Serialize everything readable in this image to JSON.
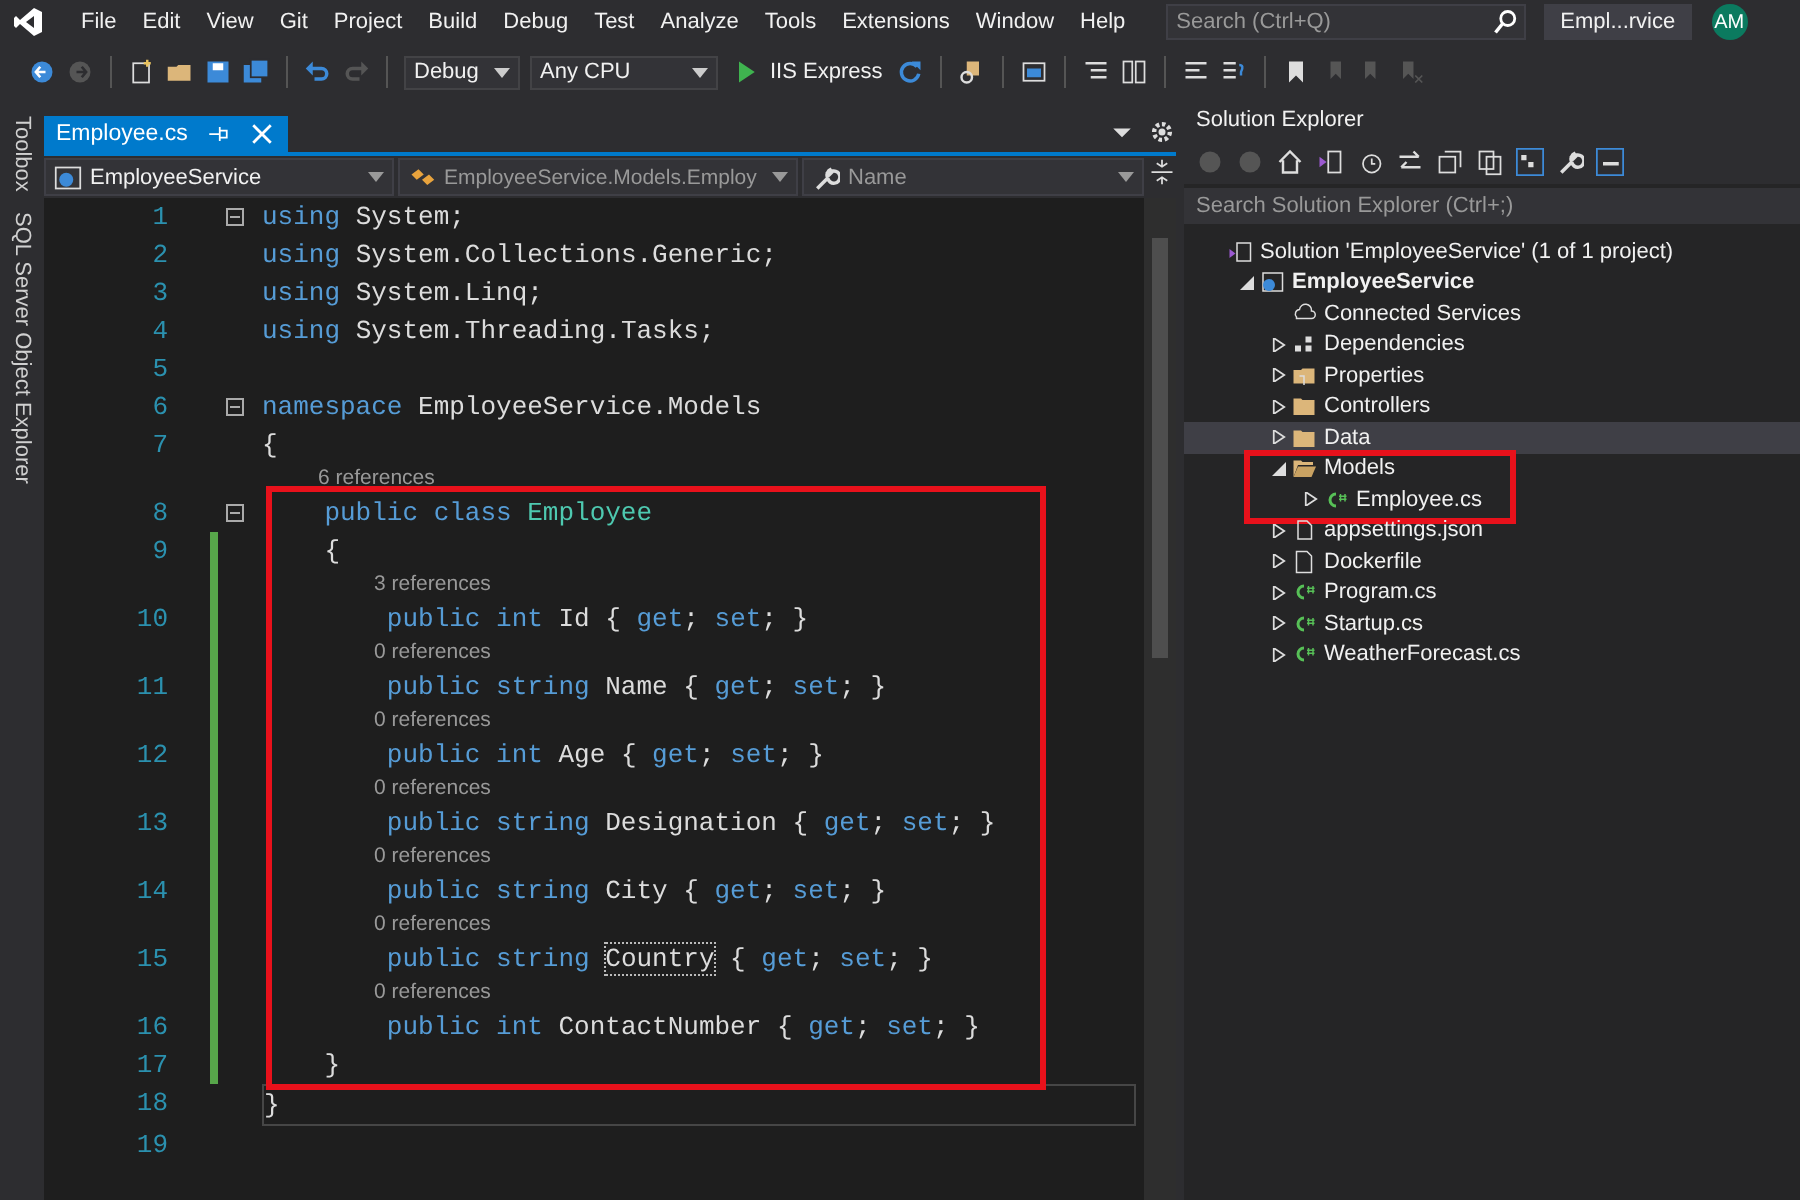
{
  "menu": {
    "items": [
      "File",
      "Edit",
      "View",
      "Git",
      "Project",
      "Build",
      "Debug",
      "Test",
      "Analyze",
      "Tools",
      "Extensions",
      "Window",
      "Help"
    ],
    "search": {
      "placeholder": "Search (Ctrl+Q)"
    },
    "solution_title": "Empl...rvice",
    "avatar": "AM"
  },
  "toolbar": {
    "configuration": "Debug",
    "platform": "Any CPU",
    "run_target": "IIS Express"
  },
  "side_tabs": [
    "Toolbox",
    "SQL Server Object Explorer"
  ],
  "editor": {
    "tab": {
      "label": "Employee.cs",
      "selected": true
    },
    "nav": [
      "EmployeeService",
      "EmployeeService.Models.Employ",
      "Name"
    ],
    "lines": [
      {
        "number": "1",
        "fold": true,
        "tokens": [
          {
            "kind": "keyword",
            "text": "using"
          },
          {
            "kind": "plain",
            "text": " System;"
          }
        ]
      },
      {
        "number": "2",
        "tokens": [
          {
            "kind": "keyword",
            "text": "using"
          },
          {
            "kind": "plain",
            "text": " System.Collections.Generic;"
          }
        ]
      },
      {
        "number": "3",
        "tokens": [
          {
            "kind": "keyword",
            "text": "using"
          },
          {
            "kind": "plain",
            "text": " System.Linq;"
          }
        ]
      },
      {
        "number": "4",
        "tokens": [
          {
            "kind": "keyword",
            "text": "using"
          },
          {
            "kind": "plain",
            "text": " System.Threading.Tasks;"
          }
        ]
      },
      {
        "number": "5"
      },
      {
        "number": "6",
        "fold": true,
        "tokens": [
          {
            "kind": "keyword",
            "text": "namespace"
          },
          {
            "kind": "plain",
            "text": " EmployeeService.Models"
          }
        ]
      },
      {
        "number": "7",
        "tokens": [
          {
            "kind": "plain",
            "text": "{"
          }
        ]
      },
      {
        "number": "8",
        "fold": true,
        "highlight": true,
        "lens": "6 references",
        "tokens": [
          {
            "kind": "keyword",
            "text": "    public class"
          },
          {
            "kind": "type",
            "text": " Employee"
          }
        ]
      },
      {
        "number": "9",
        "changed": true,
        "highlight": true,
        "tokens": [
          {
            "kind": "plain",
            "text": "    {"
          }
        ]
      },
      {
        "number": "10",
        "changed": true,
        "highlight": true,
        "lens": "3 references",
        "tokens": [
          {
            "kind": "keyword",
            "text": "        public int"
          },
          {
            "kind": "plain",
            "text": " Id { "
          },
          {
            "kind": "keyword",
            "text": "get"
          },
          {
            "kind": "plain",
            "text": "; "
          },
          {
            "kind": "keyword",
            "text": "set"
          },
          {
            "kind": "plain",
            "text": "; }"
          }
        ]
      },
      {
        "number": "11",
        "changed": true,
        "highlight": true,
        "lens": "0 references",
        "tokens": [
          {
            "kind": "keyword",
            "text": "        public string"
          },
          {
            "kind": "plain",
            "text": " Name { "
          },
          {
            "kind": "keyword",
            "text": "get"
          },
          {
            "kind": "plain",
            "text": "; "
          },
          {
            "kind": "keyword",
            "text": "set"
          },
          {
            "kind": "plain",
            "text": "; }"
          }
        ]
      },
      {
        "number": "12",
        "changed": true,
        "highlight": true,
        "lens": "0 references",
        "tokens": [
          {
            "kind": "keyword",
            "text": "        public int"
          },
          {
            "kind": "plain",
            "text": " Age { "
          },
          {
            "kind": "keyword",
            "text": "get"
          },
          {
            "kind": "plain",
            "text": "; "
          },
          {
            "kind": "keyword",
            "text": "set"
          },
          {
            "kind": "plain",
            "text": "; }"
          }
        ]
      },
      {
        "number": "13",
        "changed": true,
        "highlight": true,
        "lens": "0 references",
        "tokens": [
          {
            "kind": "keyword",
            "text": "        public string"
          },
          {
            "kind": "plain",
            "text": " Designation { "
          },
          {
            "kind": "keyword",
            "text": "get"
          },
          {
            "kind": "plain",
            "text": "; "
          },
          {
            "kind": "keyword",
            "text": "set"
          },
          {
            "kind": "plain",
            "text": "; }"
          }
        ]
      },
      {
        "number": "14",
        "changed": true,
        "highlight": true,
        "lens": "0 references",
        "tokens": [
          {
            "kind": "keyword",
            "text": "        public string"
          },
          {
            "kind": "plain",
            "text": " City { "
          },
          {
            "kind": "keyword",
            "text": "get"
          },
          {
            "kind": "plain",
            "text": "; "
          },
          {
            "kind": "keyword",
            "text": "set"
          },
          {
            "kind": "plain",
            "text": "; }"
          }
        ]
      },
      {
        "number": "15",
        "changed": true,
        "highlight": true,
        "lens": "0 references",
        "tokens": [
          {
            "kind": "keyword",
            "text": "        public string "
          },
          {
            "kind": "focus",
            "text": "Country"
          },
          {
            "kind": "plain",
            "text": " { "
          },
          {
            "kind": "keyword",
            "text": "get"
          },
          {
            "kind": "plain",
            "text": "; "
          },
          {
            "kind": "keyword",
            "text": "set"
          },
          {
            "kind": "plain",
            "text": "; }"
          }
        ]
      },
      {
        "number": "16",
        "changed": true,
        "highlight": true,
        "lens": "0 references",
        "tokens": [
          {
            "kind": "keyword",
            "text": "        public int"
          },
          {
            "kind": "plain",
            "text": " ContactNumber { "
          },
          {
            "kind": "keyword",
            "text": "get"
          },
          {
            "kind": "plain",
            "text": "; "
          },
          {
            "kind": "keyword",
            "text": "set"
          },
          {
            "kind": "plain",
            "text": "; }"
          }
        ]
      },
      {
        "number": "17",
        "changed": true,
        "highlight": true,
        "tokens": [
          {
            "kind": "plain",
            "text": "    }"
          }
        ]
      },
      {
        "number": "18",
        "current": true,
        "tokens": [
          {
            "kind": "plain",
            "text": "}"
          }
        ]
      },
      {
        "number": "19"
      }
    ]
  },
  "solution_explorer": {
    "title": "Solution Explorer",
    "search": {
      "placeholder": "Search Solution Explorer (Ctrl+;)"
    },
    "tree": [
      {
        "label": "Solution 'EmployeeService' (1 of 1 project)",
        "kind": "solution",
        "selected": false,
        "children": [
          {
            "label": "EmployeeService",
            "kind": "project",
            "expanded": true,
            "selected": false,
            "children": [
              {
                "label": "Connected Services",
                "kind": "service",
                "selected": false
              },
              {
                "label": "Dependencies",
                "kind": "dependencies",
                "expanded": false,
                "selected": false
              },
              {
                "label": "Properties",
                "kind": "properties",
                "expanded": false,
                "selected": false
              },
              {
                "label": "Controllers",
                "kind": "folder",
                "expanded": false,
                "selected": false
              },
              {
                "label": "Data",
                "kind": "folder",
                "expanded": false,
                "selected": true
              },
              {
                "label": "Models",
                "kind": "folder",
                "expanded": true,
                "highlight": true,
                "selected": false,
                "children": [
                  {
                    "label": "Employee.cs",
                    "kind": "csharp",
                    "expanded": false,
                    "selected": false
                  }
                ]
              },
              {
                "label": "appsettings.json",
                "kind": "json",
                "expanded": false,
                "selected": false
              },
              {
                "label": "Dockerfile",
                "kind": "file",
                "expanded": false,
                "selected": false
              },
              {
                "label": "Program.cs",
                "kind": "csharp",
                "expanded": false,
                "selected": false
              },
              {
                "label": "Startup.cs",
                "kind": "csharp",
                "expanded": false,
                "selected": false
              },
              {
                "label": "WeatherForecast.cs",
                "kind": "csharp",
                "expanded": false,
                "selected": false
              }
            ]
          }
        ]
      }
    ]
  }
}
